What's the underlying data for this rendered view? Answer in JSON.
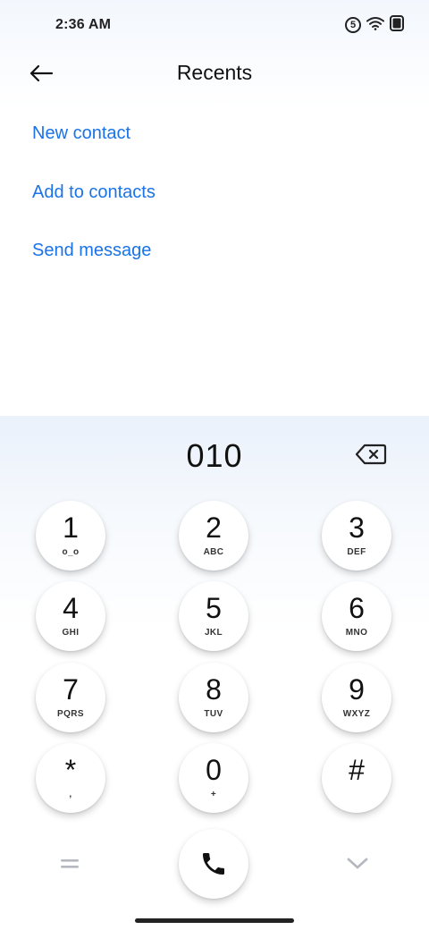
{
  "status_bar": {
    "time": "2:36 AM",
    "badge_text": "5",
    "icons": [
      "notification-5-icon",
      "wifi-icon",
      "battery-icon"
    ]
  },
  "app_bar": {
    "title": "Recents",
    "back_icon": "back-arrow-icon"
  },
  "actions": [
    {
      "label": "New contact"
    },
    {
      "label": "Add to contacts"
    },
    {
      "label": "Send message"
    }
  ],
  "dialpad": {
    "number": "010",
    "backspace_icon": "backspace-icon",
    "keys": [
      {
        "digit": "1",
        "letters": "o_o"
      },
      {
        "digit": "2",
        "letters": "ABC"
      },
      {
        "digit": "3",
        "letters": "DEF"
      },
      {
        "digit": "4",
        "letters": "GHI"
      },
      {
        "digit": "5",
        "letters": "JKL"
      },
      {
        "digit": "6",
        "letters": "MNO"
      },
      {
        "digit": "7",
        "letters": "PQRS"
      },
      {
        "digit": "8",
        "letters": "TUV"
      },
      {
        "digit": "9",
        "letters": "WXYZ"
      },
      {
        "digit": "*",
        "letters": ","
      },
      {
        "digit": "0",
        "letters": "+"
      },
      {
        "digit": "#",
        "letters": ""
      }
    ],
    "bottom_icons": {
      "left": "menu-lines-icon",
      "center": "phone-call-icon",
      "right": "chevron-down-icon"
    }
  },
  "colors": {
    "accent": "#1a73e8",
    "text": "#111111",
    "dialpad_bg": "#eaf1fb"
  }
}
